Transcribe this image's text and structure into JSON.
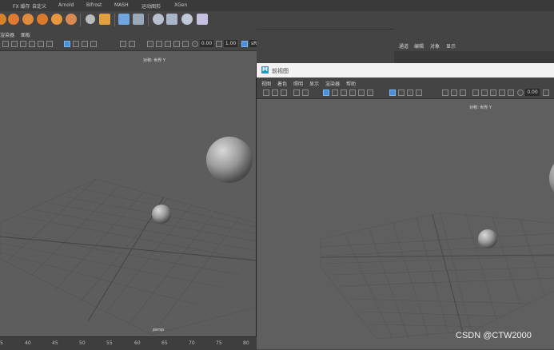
{
  "shelf_tabs": [
    "FX 缓存",
    "自定义",
    "Arnold",
    "Bifrost",
    "MASH",
    "运动图形",
    "XGen"
  ],
  "left_viewport": {
    "menu": [
      "渲染器",
      "面板"
    ],
    "exposure": "0.00",
    "gamma": "1.00",
    "color_space": "sRGB gamma",
    "top_label": "对称: 世界 Y",
    "camera_label": "persp"
  },
  "channel_box": {
    "tabs": [
      "通道",
      "编辑",
      "对象",
      "显示"
    ]
  },
  "front_window": {
    "title": "前视图",
    "menu": [
      "视图",
      "着色",
      "照明",
      "显示",
      "渲染器",
      "帮助"
    ],
    "exposure": "0.00",
    "top_label": "对称: 世界 Y"
  },
  "timeline": {
    "ticks": [
      "5",
      "40",
      "45",
      "50",
      "55",
      "60",
      "65",
      "70",
      "75",
      "80"
    ]
  },
  "watermark": "CSDN @CTW2000",
  "colors": {
    "viewport_bg": "#5d5d5d",
    "grid_line": "#505050",
    "accent": "#4a90d9"
  }
}
